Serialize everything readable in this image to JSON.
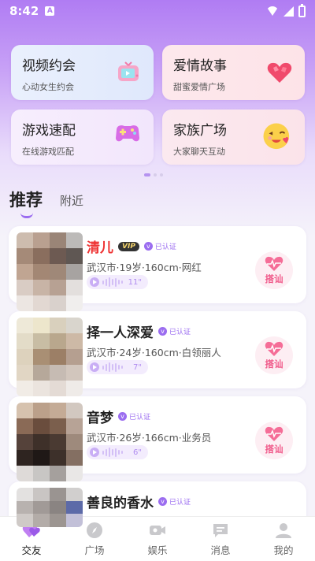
{
  "status_bar": {
    "time": "8:42",
    "notification_badge": "A"
  },
  "feature_cards": [
    {
      "title": "视频约会",
      "subtitle": "心动女生约会",
      "icon": "tv-icon"
    },
    {
      "title": "爱情故事",
      "subtitle": "甜蜜爱情广场",
      "icon": "heart-icon"
    },
    {
      "title": "游戏速配",
      "subtitle": "在线游戏匹配",
      "icon": "gamepad-icon"
    },
    {
      "title": "家族广场",
      "subtitle": "大家聊天互动",
      "icon": "emoji-icon"
    }
  ],
  "tabs": {
    "active": "推荐",
    "other": "附近"
  },
  "users": [
    {
      "name": "清儿",
      "vip": "VIP",
      "verified": "已认证",
      "info": "武汉市·19岁·160cm·网红",
      "voice_duration": "11\"",
      "greet": "搭讪",
      "name_color": "red"
    },
    {
      "name": "择一人深爱",
      "vip": "",
      "verified": "已认证",
      "info": "武汉市·24岁·160cm·白领丽人",
      "voice_duration": "7\"",
      "greet": "搭讪",
      "name_color": "normal"
    },
    {
      "name": "音梦",
      "vip": "",
      "verified": "已认证",
      "info": "武汉市·26岁·166cm·业务员",
      "voice_duration": "6\"",
      "greet": "搭讪",
      "name_color": "normal"
    },
    {
      "name": "善良的香水",
      "vip": "",
      "verified": "已认证",
      "info": "",
      "voice_duration": "",
      "greet": "",
      "name_color": "normal"
    }
  ],
  "bottom_nav": [
    {
      "label": "交友",
      "icon": "hearts-icon",
      "active": true
    },
    {
      "label": "广场",
      "icon": "compass-icon",
      "active": false
    },
    {
      "label": "娱乐",
      "icon": "video-icon",
      "active": false
    },
    {
      "label": "消息",
      "icon": "message-icon",
      "active": false
    },
    {
      "label": "我的",
      "icon": "profile-icon",
      "active": false
    }
  ],
  "colors": {
    "accent": "#9b6df0",
    "greet": "#f05a8a",
    "vip_name": "#e33333"
  }
}
